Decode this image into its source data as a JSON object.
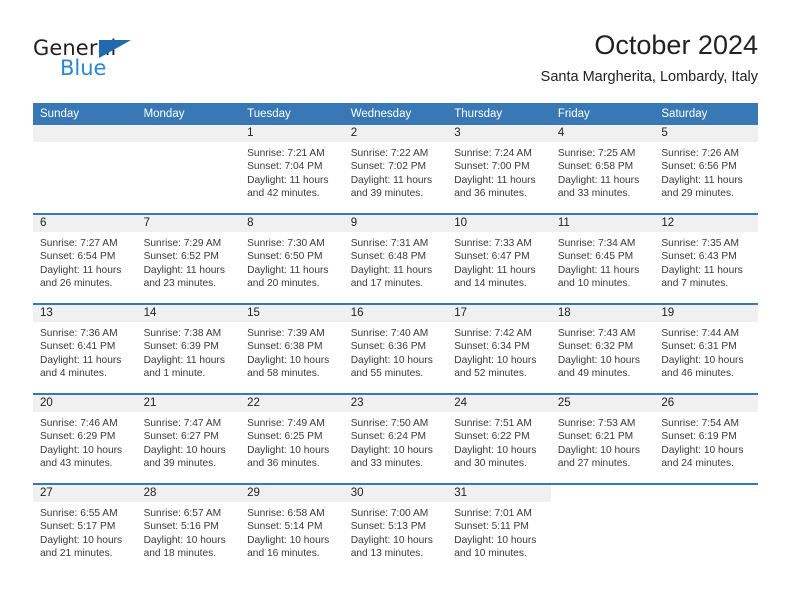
{
  "brand": {
    "name_part1": "General",
    "name_part2": "Blue",
    "triangle_color": "#1e6bb0",
    "blue_color": "#2b87d4"
  },
  "header": {
    "title": "October 2024",
    "subtitle": "Santa Margherita, Lombardy, Italy"
  },
  "theme": {
    "header_bar": "#3878b4",
    "day_band": "#f0f0f0",
    "text": "#3a3a3a"
  },
  "weekdays": [
    "Sunday",
    "Monday",
    "Tuesday",
    "Wednesday",
    "Thursday",
    "Friday",
    "Saturday"
  ],
  "weeks": [
    [
      {
        "day": "",
        "sunrise": "",
        "sunset": "",
        "daylight1": "",
        "daylight2": ""
      },
      {
        "day": "",
        "sunrise": "",
        "sunset": "",
        "daylight1": "",
        "daylight2": ""
      },
      {
        "day": "1",
        "sunrise": "Sunrise: 7:21 AM",
        "sunset": "Sunset: 7:04 PM",
        "daylight1": "Daylight: 11 hours",
        "daylight2": "and 42 minutes."
      },
      {
        "day": "2",
        "sunrise": "Sunrise: 7:22 AM",
        "sunset": "Sunset: 7:02 PM",
        "daylight1": "Daylight: 11 hours",
        "daylight2": "and 39 minutes."
      },
      {
        "day": "3",
        "sunrise": "Sunrise: 7:24 AM",
        "sunset": "Sunset: 7:00 PM",
        "daylight1": "Daylight: 11 hours",
        "daylight2": "and 36 minutes."
      },
      {
        "day": "4",
        "sunrise": "Sunrise: 7:25 AM",
        "sunset": "Sunset: 6:58 PM",
        "daylight1": "Daylight: 11 hours",
        "daylight2": "and 33 minutes."
      },
      {
        "day": "5",
        "sunrise": "Sunrise: 7:26 AM",
        "sunset": "Sunset: 6:56 PM",
        "daylight1": "Daylight: 11 hours",
        "daylight2": "and 29 minutes."
      }
    ],
    [
      {
        "day": "6",
        "sunrise": "Sunrise: 7:27 AM",
        "sunset": "Sunset: 6:54 PM",
        "daylight1": "Daylight: 11 hours",
        "daylight2": "and 26 minutes."
      },
      {
        "day": "7",
        "sunrise": "Sunrise: 7:29 AM",
        "sunset": "Sunset: 6:52 PM",
        "daylight1": "Daylight: 11 hours",
        "daylight2": "and 23 minutes."
      },
      {
        "day": "8",
        "sunrise": "Sunrise: 7:30 AM",
        "sunset": "Sunset: 6:50 PM",
        "daylight1": "Daylight: 11 hours",
        "daylight2": "and 20 minutes."
      },
      {
        "day": "9",
        "sunrise": "Sunrise: 7:31 AM",
        "sunset": "Sunset: 6:48 PM",
        "daylight1": "Daylight: 11 hours",
        "daylight2": "and 17 minutes."
      },
      {
        "day": "10",
        "sunrise": "Sunrise: 7:33 AM",
        "sunset": "Sunset: 6:47 PM",
        "daylight1": "Daylight: 11 hours",
        "daylight2": "and 14 minutes."
      },
      {
        "day": "11",
        "sunrise": "Sunrise: 7:34 AM",
        "sunset": "Sunset: 6:45 PM",
        "daylight1": "Daylight: 11 hours",
        "daylight2": "and 10 minutes."
      },
      {
        "day": "12",
        "sunrise": "Sunrise: 7:35 AM",
        "sunset": "Sunset: 6:43 PM",
        "daylight1": "Daylight: 11 hours",
        "daylight2": "and 7 minutes."
      }
    ],
    [
      {
        "day": "13",
        "sunrise": "Sunrise: 7:36 AM",
        "sunset": "Sunset: 6:41 PM",
        "daylight1": "Daylight: 11 hours",
        "daylight2": "and 4 minutes."
      },
      {
        "day": "14",
        "sunrise": "Sunrise: 7:38 AM",
        "sunset": "Sunset: 6:39 PM",
        "daylight1": "Daylight: 11 hours",
        "daylight2": "and 1 minute."
      },
      {
        "day": "15",
        "sunrise": "Sunrise: 7:39 AM",
        "sunset": "Sunset: 6:38 PM",
        "daylight1": "Daylight: 10 hours",
        "daylight2": "and 58 minutes."
      },
      {
        "day": "16",
        "sunrise": "Sunrise: 7:40 AM",
        "sunset": "Sunset: 6:36 PM",
        "daylight1": "Daylight: 10 hours",
        "daylight2": "and 55 minutes."
      },
      {
        "day": "17",
        "sunrise": "Sunrise: 7:42 AM",
        "sunset": "Sunset: 6:34 PM",
        "daylight1": "Daylight: 10 hours",
        "daylight2": "and 52 minutes."
      },
      {
        "day": "18",
        "sunrise": "Sunrise: 7:43 AM",
        "sunset": "Sunset: 6:32 PM",
        "daylight1": "Daylight: 10 hours",
        "daylight2": "and 49 minutes."
      },
      {
        "day": "19",
        "sunrise": "Sunrise: 7:44 AM",
        "sunset": "Sunset: 6:31 PM",
        "daylight1": "Daylight: 10 hours",
        "daylight2": "and 46 minutes."
      }
    ],
    [
      {
        "day": "20",
        "sunrise": "Sunrise: 7:46 AM",
        "sunset": "Sunset: 6:29 PM",
        "daylight1": "Daylight: 10 hours",
        "daylight2": "and 43 minutes."
      },
      {
        "day": "21",
        "sunrise": "Sunrise: 7:47 AM",
        "sunset": "Sunset: 6:27 PM",
        "daylight1": "Daylight: 10 hours",
        "daylight2": "and 39 minutes."
      },
      {
        "day": "22",
        "sunrise": "Sunrise: 7:49 AM",
        "sunset": "Sunset: 6:25 PM",
        "daylight1": "Daylight: 10 hours",
        "daylight2": "and 36 minutes."
      },
      {
        "day": "23",
        "sunrise": "Sunrise: 7:50 AM",
        "sunset": "Sunset: 6:24 PM",
        "daylight1": "Daylight: 10 hours",
        "daylight2": "and 33 minutes."
      },
      {
        "day": "24",
        "sunrise": "Sunrise: 7:51 AM",
        "sunset": "Sunset: 6:22 PM",
        "daylight1": "Daylight: 10 hours",
        "daylight2": "and 30 minutes."
      },
      {
        "day": "25",
        "sunrise": "Sunrise: 7:53 AM",
        "sunset": "Sunset: 6:21 PM",
        "daylight1": "Daylight: 10 hours",
        "daylight2": "and 27 minutes."
      },
      {
        "day": "26",
        "sunrise": "Sunrise: 7:54 AM",
        "sunset": "Sunset: 6:19 PM",
        "daylight1": "Daylight: 10 hours",
        "daylight2": "and 24 minutes."
      }
    ],
    [
      {
        "day": "27",
        "sunrise": "Sunrise: 6:55 AM",
        "sunset": "Sunset: 5:17 PM",
        "daylight1": "Daylight: 10 hours",
        "daylight2": "and 21 minutes."
      },
      {
        "day": "28",
        "sunrise": "Sunrise: 6:57 AM",
        "sunset": "Sunset: 5:16 PM",
        "daylight1": "Daylight: 10 hours",
        "daylight2": "and 18 minutes."
      },
      {
        "day": "29",
        "sunrise": "Sunrise: 6:58 AM",
        "sunset": "Sunset: 5:14 PM",
        "daylight1": "Daylight: 10 hours",
        "daylight2": "and 16 minutes."
      },
      {
        "day": "30",
        "sunrise": "Sunrise: 7:00 AM",
        "sunset": "Sunset: 5:13 PM",
        "daylight1": "Daylight: 10 hours",
        "daylight2": "and 13 minutes."
      },
      {
        "day": "31",
        "sunrise": "Sunrise: 7:01 AM",
        "sunset": "Sunset: 5:11 PM",
        "daylight1": "Daylight: 10 hours",
        "daylight2": "and 10 minutes."
      },
      {
        "day": "",
        "sunrise": "",
        "sunset": "",
        "daylight1": "",
        "daylight2": ""
      },
      {
        "day": "",
        "sunrise": "",
        "sunset": "",
        "daylight1": "",
        "daylight2": ""
      }
    ]
  ]
}
